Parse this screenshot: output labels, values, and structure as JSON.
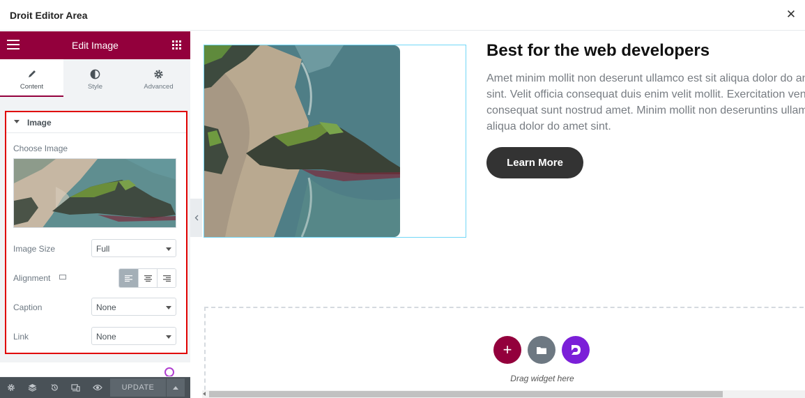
{
  "window": {
    "title": "Droit Editor Area",
    "close_label": "✕"
  },
  "panel": {
    "title": "Edit Image",
    "accent_color": "#93003c",
    "tabs": [
      {
        "label": "Content",
        "icon": "pencil-icon",
        "active": true
      },
      {
        "label": "Style",
        "icon": "half-circle-icon",
        "active": false
      },
      {
        "label": "Advanced",
        "icon": "gear-icon",
        "active": false
      }
    ],
    "section": {
      "title": "Image",
      "choose_image_label": "Choose Image",
      "image_size": {
        "label": "Image Size",
        "value": "Full"
      },
      "alignment": {
        "label": "Alignment",
        "selected": "left",
        "options": [
          "left",
          "center",
          "right"
        ]
      },
      "caption": {
        "label": "Caption",
        "value": "None"
      },
      "link": {
        "label": "Link",
        "value": "None"
      }
    },
    "footer": {
      "icons": [
        "gear-icon",
        "layers-icon",
        "history-icon",
        "responsive-icon",
        "eye-icon"
      ],
      "update_label": "UPDATE"
    }
  },
  "canvas": {
    "heading": "Best for the web developers",
    "paragraph_lines": [
      "Amet minim mollit non deserunt ullamco est sit aliqua dolor do amet",
      "sint. Velit officia consequat duis enim velit mollit. Exercitation veniam",
      "consequat sunt nostrud amet. Minim mollit non deseruntins ullamco est sit",
      "aliqua dolor do amet sint."
    ],
    "button_label": "Learn More",
    "drag_text": "Drag widget here",
    "add_button_symbol": "+"
  }
}
